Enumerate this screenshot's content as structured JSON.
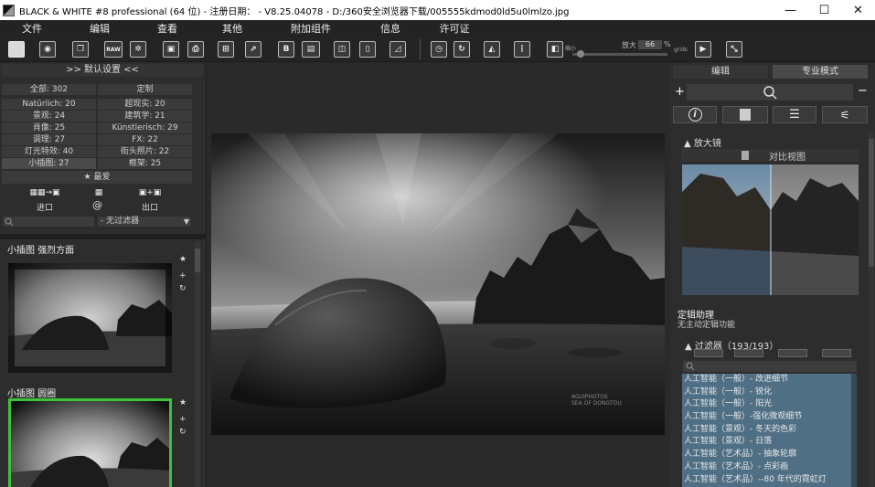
{
  "window": {
    "title": "BLACK & WHITE #8 professional (64 位) - 注册日期： - V8.25.04078 - D:/360安全浏览器下载/005555kdmod0ld5u0lmlzo.jpg",
    "minimize": "—",
    "maximize": "☐",
    "close": "✕"
  },
  "menu": [
    "文件",
    "编辑",
    "查看",
    "其他",
    "附加组件",
    "信息",
    "许可证"
  ],
  "toolbar": {
    "raw_label": "RAW",
    "zoom_small_label": "缩小",
    "zoom_label": "放大",
    "zoom_value": "66",
    "zoom_unit": "%",
    "zoom_level": 0.05,
    "grid_label": "grids"
  },
  "presets": {
    "header": ">> 默认设置 <<",
    "categories": [
      [
        "全部: 302",
        "定制"
      ],
      [
        "Natürlich: 20",
        "超现实: 20"
      ],
      [
        "景观: 24",
        "建筑学: 21"
      ],
      [
        "肖像: 25",
        "Künstlerisch: 29"
      ],
      [
        "调理: 27",
        "FX: 22"
      ],
      [
        "灯光特效: 40",
        "街头照片: 22"
      ],
      [
        "小插图: 27",
        "框架: 25"
      ]
    ],
    "favorites": "★ 最爱",
    "import_label": "进口",
    "at_label": "@",
    "export_label": "出口",
    "filter_select": "- 无过滤器"
  },
  "thumbnails": [
    {
      "title": "小插图 强烈方面",
      "star": "★",
      "plus": "+",
      "refresh": "↻",
      "selected": false
    },
    {
      "title": "小插图 圆圈",
      "star": "★",
      "plus": "+",
      "refresh": "↻",
      "selected": true
    }
  ],
  "main_image": {
    "watermark_line1": "AGUIPHOTOS",
    "watermark_line2": "SEA OF DONGTOU"
  },
  "right": {
    "tab_edit": "编辑",
    "tab_pro": "专业模式",
    "plus": "+",
    "minus": "−",
    "info_icon": "i",
    "loupe_title": "放大镜",
    "compare_label": "对比视图",
    "help_title": "定辑助理",
    "help_text": "无主动定辑功能",
    "filters_title": "过滤器（193/193）",
    "filters": [
      "人工智能（一般）- 改进细节",
      "人工智能（一般）- 锐化",
      "人工智能（一般）- 阳光",
      "人工智能（一般）-强化微观细节",
      "人工智能（景观）- 冬天的色彩",
      "人工智能（景观）- 日落",
      "人工智能（艺术品）- 抽象轮廓",
      "人工智能（艺术品）- 点彩画",
      "人工智能（艺术品）--80 年代的霓虹灯"
    ]
  },
  "colors": {
    "selection_border": "#3ec23a",
    "filter_list_bg": "#4f6f84"
  }
}
